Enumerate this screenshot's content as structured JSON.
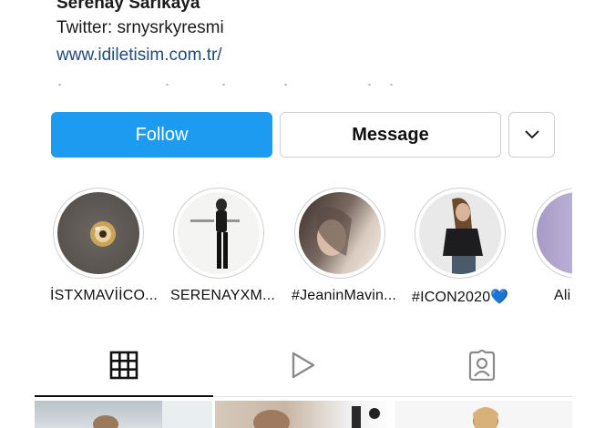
{
  "profile": {
    "name": "Serenay Sarıkaya",
    "twitter": "Twitter: srnysrkyresmi",
    "website": "www.idiletisim.com.tr/"
  },
  "actions": {
    "follow_label": "Follow",
    "message_label": "Message",
    "more_icon": "chevron-down-icon"
  },
  "highlights": [
    {
      "label": "İSTXMAVİİCO..."
    },
    {
      "label": "SERENAYXM..."
    },
    {
      "label": "#JeaninMavin..."
    },
    {
      "label": "#ICON2020💙"
    },
    {
      "label": "Ali"
    }
  ],
  "tabs": [
    {
      "icon": "grid-icon",
      "active": true
    },
    {
      "icon": "reels-play-icon",
      "active": false
    },
    {
      "icon": "tagged-user-icon",
      "active": false
    }
  ],
  "colors": {
    "follow_bg": "#1c9bf0",
    "link": "#1f4a7c",
    "border": "#cfcfcf"
  }
}
